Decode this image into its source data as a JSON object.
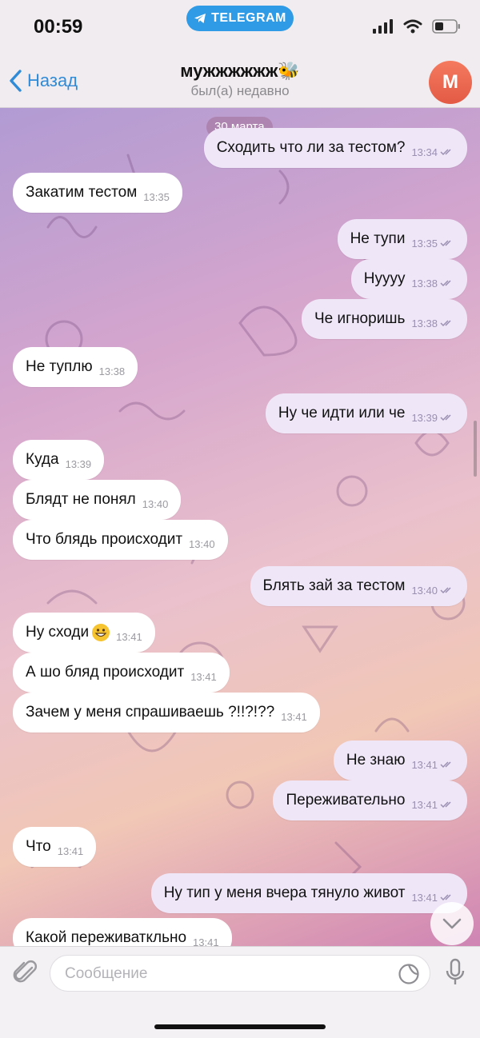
{
  "status_bar": {
    "time": "00:59",
    "app_pill": "TELEGRAM"
  },
  "header": {
    "back_label": "Назад",
    "title": "мужжжжжж🐝",
    "subtitle": "был(а) недавно",
    "avatar_letter": "М"
  },
  "chat": {
    "date": "30 марта",
    "messages": [
      {
        "dir": "out",
        "text": "Сходить что ли за тестом?",
        "time": "13:34",
        "read": true
      },
      {
        "dir": "in",
        "text": "Закатим тестом",
        "time": "13:35"
      },
      {
        "dir": "out",
        "text": "Не тупи",
        "time": "13:35",
        "read": true
      },
      {
        "dir": "out",
        "text": "Нуууу",
        "time": "13:38",
        "read": true
      },
      {
        "dir": "out",
        "text": "Че игноришь",
        "time": "13:38",
        "read": true
      },
      {
        "dir": "in",
        "text": "Не туплю",
        "time": "13:38"
      },
      {
        "dir": "out",
        "text": "Ну че идти или че",
        "time": "13:39",
        "read": true
      },
      {
        "dir": "in",
        "text": "Куда",
        "time": "13:39"
      },
      {
        "dir": "in",
        "text": "Блядт не понял",
        "time": "13:40"
      },
      {
        "dir": "in",
        "text": "Что блядь происходит",
        "time": "13:40"
      },
      {
        "dir": "out",
        "text": "Блять зай за тестом",
        "time": "13:40",
        "read": true
      },
      {
        "dir": "in",
        "text": "Ну сходи",
        "time": "13:41",
        "emoji": "grinning-face"
      },
      {
        "dir": "in",
        "text": "А шо бляд происходит",
        "time": "13:41"
      },
      {
        "dir": "in",
        "text": "Зачем у меня спрашиваешь ?!!?!??",
        "time": "13:41"
      },
      {
        "dir": "out",
        "text": "Не знаю",
        "time": "13:41",
        "read": true
      },
      {
        "dir": "out",
        "text": "Переживательно",
        "time": "13:41",
        "read": true
      },
      {
        "dir": "in",
        "text": "Что",
        "time": "13:41"
      },
      {
        "dir": "out",
        "text": "Ну тип у меня вчера тянуло живот",
        "time": "13:41",
        "read": true
      },
      {
        "dir": "in",
        "text": "Какой переживаткльно",
        "time": "13:41"
      }
    ]
  },
  "input": {
    "placeholder": "Сообщение"
  },
  "colors": {
    "accent": "#2f8bd8",
    "outgoing_bubble": "#efe6f8",
    "incoming_bubble": "#ffffff",
    "avatar": "#e8654e"
  }
}
